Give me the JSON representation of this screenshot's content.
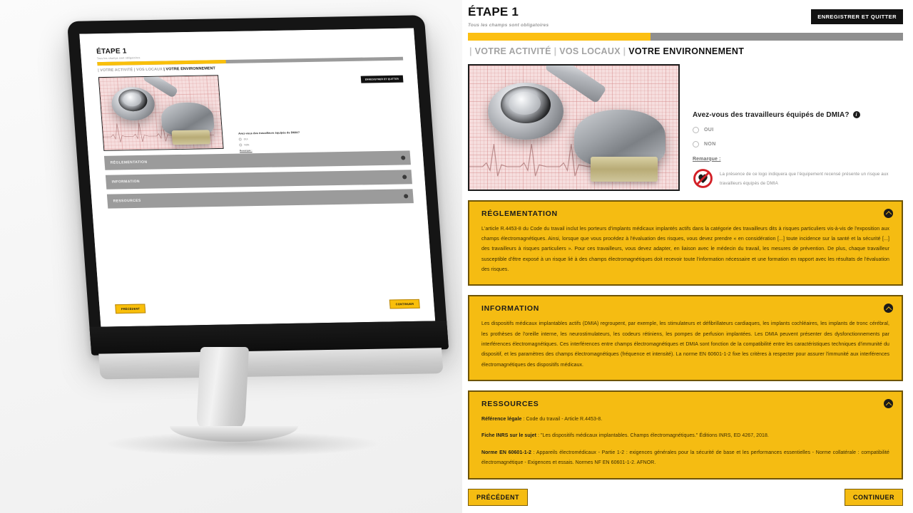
{
  "header": {
    "step_title": "ÉTAPE 1",
    "subtitle": "Tous les champs sont obligatoires",
    "save_quit_label": "ENREGISTRER ET QUITTER",
    "progress_percent": 42
  },
  "breadcrumb": {
    "sep": "|",
    "items": [
      {
        "label": "VOTRE ACTIVITÉ",
        "active": false
      },
      {
        "label": "VOS LOCAUX",
        "active": false
      },
      {
        "label": "VOTRE ENVIRONNEMENT",
        "active": true
      }
    ]
  },
  "illustration": {
    "alt": "Stéthoscope et stimulateur cardiaque posés sur un tracé électrocardiogramme",
    "icon": "stethoscope-pacemaker-photo"
  },
  "question": {
    "label": "Avez-vous des travailleurs équipés de DMIA?",
    "info_icon": "info-icon",
    "options": [
      {
        "value": "oui",
        "label": "OUI",
        "selected": false
      },
      {
        "value": "non",
        "label": "NON",
        "selected": false
      }
    ],
    "remark_label": "Remarque :",
    "remark_icon": "no-pacemaker-prohibition-icon",
    "remark_text": "La présence de ce logo indiquera que l'équipement recensé présente un risque aux travailleurs équipés de DMIA"
  },
  "accordions": [
    {
      "title": "RÉGLEMENTATION",
      "toggle_icon": "chevron-up-icon",
      "expanded": true,
      "body": "L'article R.4453-8 du Code du travail inclut les porteurs d'implants médicaux implantés actifs dans la catégorie des travailleurs dits à risques particuliers vis-à-vis de l'exposition aux champs électromagnétiques. Ainsi, lorsque que vous procédez à l'évaluation des risques, vous devez prendre « en considération [...] toute incidence sur la santé et la sécurité [...] des travailleurs à risques particuliers ». Pour ces travailleurs, vous devez adapter, en liaison avec le médecin du travail, les mesures de prévention. De plus, chaque travailleur susceptible d'être exposé à un risque lié à des champs électromagnétiques doit recevoir toute l'information nécessaire et une formation en rapport avec les résultats de l'évaluation des risques."
    },
    {
      "title": "INFORMATION",
      "toggle_icon": "chevron-up-icon",
      "expanded": true,
      "body": "Les dispositifs médicaux implantables actifs (DMIA) regroupent, par exemple, les stimulateurs et défibrillateurs cardiaques, les implants cochléaires, les implants de tronc cérébral, les prothèses de l'oreille interne, les neurostimulateurs, les codeurs rétiniens, les pompes de perfusion implantées. Les DMIA peuvent présenter des dysfonctionnements par interférences électromagnétiques. Ces interférences entre champs électromagnétiques et DMIA sont fonction de la compatibilité entre les caractéristiques techniques d'immunité du dispositif, et les paramètres des champs électromagnétiques (fréquence et intensité). La norme EN 60601-1-2 fixe les critères à respecter pour assurer l'immunité aux interférences électromagnétiques des dispositifs médicaux."
    }
  ],
  "resources": {
    "title": "RESSOURCES",
    "toggle_icon": "chevron-up-icon",
    "expanded": true,
    "lines": [
      {
        "term": "Référence légale",
        "text": " : Code du travail - Article R.4453-8."
      },
      {
        "term": "Fiche INRS sur le sujet",
        "text": " : \"Les dispositifs médicaux implantables. Champs électromagnétiques.\" Éditions INRS, ED 4267, 2018."
      },
      {
        "term": "Norme EN 60601-1-2",
        "text": " : Appareils électromédicaux - Partie 1-2 : exigences générales pour la sécurité de base et les performances essentielles - Norme collatérale : compatibilité électromagnétique - Exigences et essais. Normes NF EN 60601-1-2. AFNOR."
      }
    ]
  },
  "footer": {
    "previous_label": "PRÉCÉDENT",
    "continue_label": "CONTINUER"
  },
  "mockup": {
    "device_icon": "desktop-monitor-mockup",
    "step_title": "ÉTAPE 1",
    "subtitle": "Tous les champs sont obligatoires",
    "save_quit_label": "ENREGISTRER ET QUITTER",
    "crumb_inactive_1": "| VOTRE ACTIVITÉ ",
    "crumb_inactive_2": "| VOS LOCAUX ",
    "crumb_active": "| VOTRE ENVIRONNEMENT",
    "question": "Avez-vous des travailleurs équipés de DMIA?",
    "option_oui": "OUI",
    "option_non": "NON",
    "remark_label": "Remarque :",
    "remark_text": "La présence de ce logo indiquera que l'équipement recensé présente un risque aux travailleurs équipés de DMIA",
    "acc_1": "RÉGLEMENTATION",
    "acc_2": "INFORMATION",
    "acc_3": "RESSOURCES",
    "previous_label": "PRÉCÉDENT",
    "continue_label": "CONTINUER"
  },
  "colors": {
    "brand_yellow": "#f5bc12",
    "progress_yellow": "#fcbf12",
    "progress_track": "#8f8f8f",
    "ink": "#111111",
    "accordion_border": "#6e5405",
    "prohibition_red": "#d32027"
  }
}
